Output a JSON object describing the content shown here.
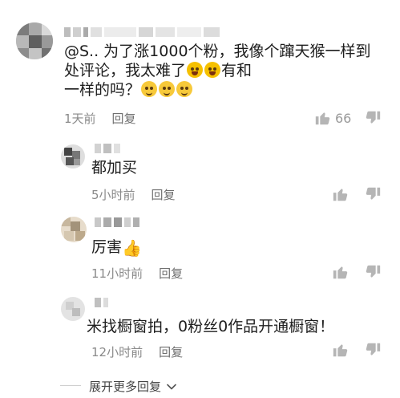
{
  "comments": [
    {
      "avatar": "blurred-avatar",
      "text_lines": [
        "@S.. 为了涨1000个粉，我像个蹿天猴一样到",
        "处评论，我太难了",
        "有和",
        "一样的吗？"
      ],
      "time": "1天前",
      "reply_label": "回复",
      "like_count": "66",
      "emoji_laugh": "laughing-crying-emoji",
      "emoji_shy": "shy-face-emoji"
    },
    {
      "avatar": "blurred-avatar",
      "text": "都加买",
      "time": "5小时前",
      "reply_label": "回复"
    },
    {
      "avatar": "blurred-avatar",
      "text": "厉害",
      "time": "11小时前",
      "reply_label": "回复",
      "emoji": "thumbs-up-emoji"
    },
    {
      "avatar": "blurred-avatar",
      "text": "米找橱窗拍，0粉丝0作品开通橱窗！",
      "time": "12小时前",
      "reply_label": "回复"
    }
  ],
  "expand_more": "展开更多回复",
  "icons": {
    "like": "thumbs-up-icon",
    "dislike": "thumbs-down-icon",
    "expand": "chevron-down-icon"
  },
  "colors": {
    "meta_gray": "#8a8a8a",
    "icon_gray": "#b5b5b5",
    "emoji_yellow": "#f7c93a"
  }
}
